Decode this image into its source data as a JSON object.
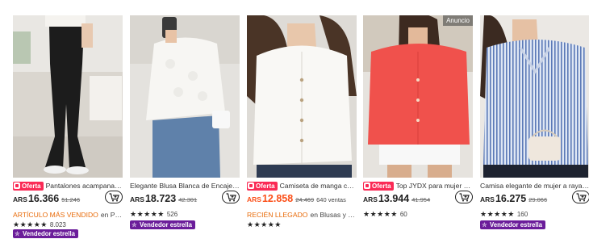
{
  "products": [
    {
      "ad_label": "",
      "offer_label": "Oferta",
      "title": "Pantalones acampanados el...",
      "currency": "ARS",
      "price": "16.366",
      "old_price": "51.246",
      "sold": "",
      "line3_highlight": "ARTÍCULO MÁS VENDIDO",
      "line3_rest": "en Pantal...",
      "stars": "★★★★★",
      "reviews": "8.023",
      "seller_badge": "Vendedor estrella",
      "image_icon": "black-flare-pants-photo"
    },
    {
      "ad_label": "",
      "offer_label": "",
      "title": "Elegante Blusa Blanca de Encaje Bordad...",
      "currency": "ARS",
      "price": "18.723",
      "old_price": "42.301",
      "sold": "",
      "line3_highlight": "",
      "line3_rest": "",
      "stars": "★★★★★",
      "reviews": "526",
      "seller_badge": "Vendedor estrella",
      "image_icon": "white-lace-blouse-photo"
    },
    {
      "ad_label": "",
      "offer_label": "Oferta",
      "title": "Camiseta de manga corta co...",
      "currency": "ARS",
      "price": "12.858",
      "old_price": "24.469",
      "sold": "640 ventas",
      "line3_highlight": "RECIÉN LLEGADO",
      "line3_rest": "en Blusas y camisa...",
      "stars": "★★★★★",
      "reviews": "",
      "seller_badge": "",
      "image_icon": "white-button-shirt-photo"
    },
    {
      "ad_label": "Anuncio",
      "offer_label": "Oferta",
      "title": "Top JYDX para mujer con bo...",
      "currency": "ARS",
      "price": "13.944",
      "old_price": "41.954",
      "sold": "",
      "line3_highlight": "",
      "line3_rest": "",
      "stars": "★★★★★",
      "reviews": "60",
      "seller_badge": "",
      "image_icon": "red-linen-top-photo"
    },
    {
      "ad_label": "",
      "offer_label": "",
      "title": "Camisa elegante de mujer a rayas par...",
      "currency": "ARS",
      "price": "16.275",
      "old_price": "29.066",
      "sold": "",
      "line3_highlight": "",
      "line3_rest": "",
      "stars": "★★★★★",
      "reviews": "160",
      "seller_badge": "Vendedor estrella",
      "image_icon": "blue-striped-shirt-photo"
    }
  ],
  "colors": {
    "offer_bg": "#fa2a55",
    "price_red": "#fb4e17",
    "highlight_orange": "#e86b0a",
    "seller_bg": "#6b1d9a"
  },
  "icons": {
    "cart": "add-to-cart-icon",
    "offer": "offer-tag-icon",
    "seller": "star-seller-icon"
  }
}
